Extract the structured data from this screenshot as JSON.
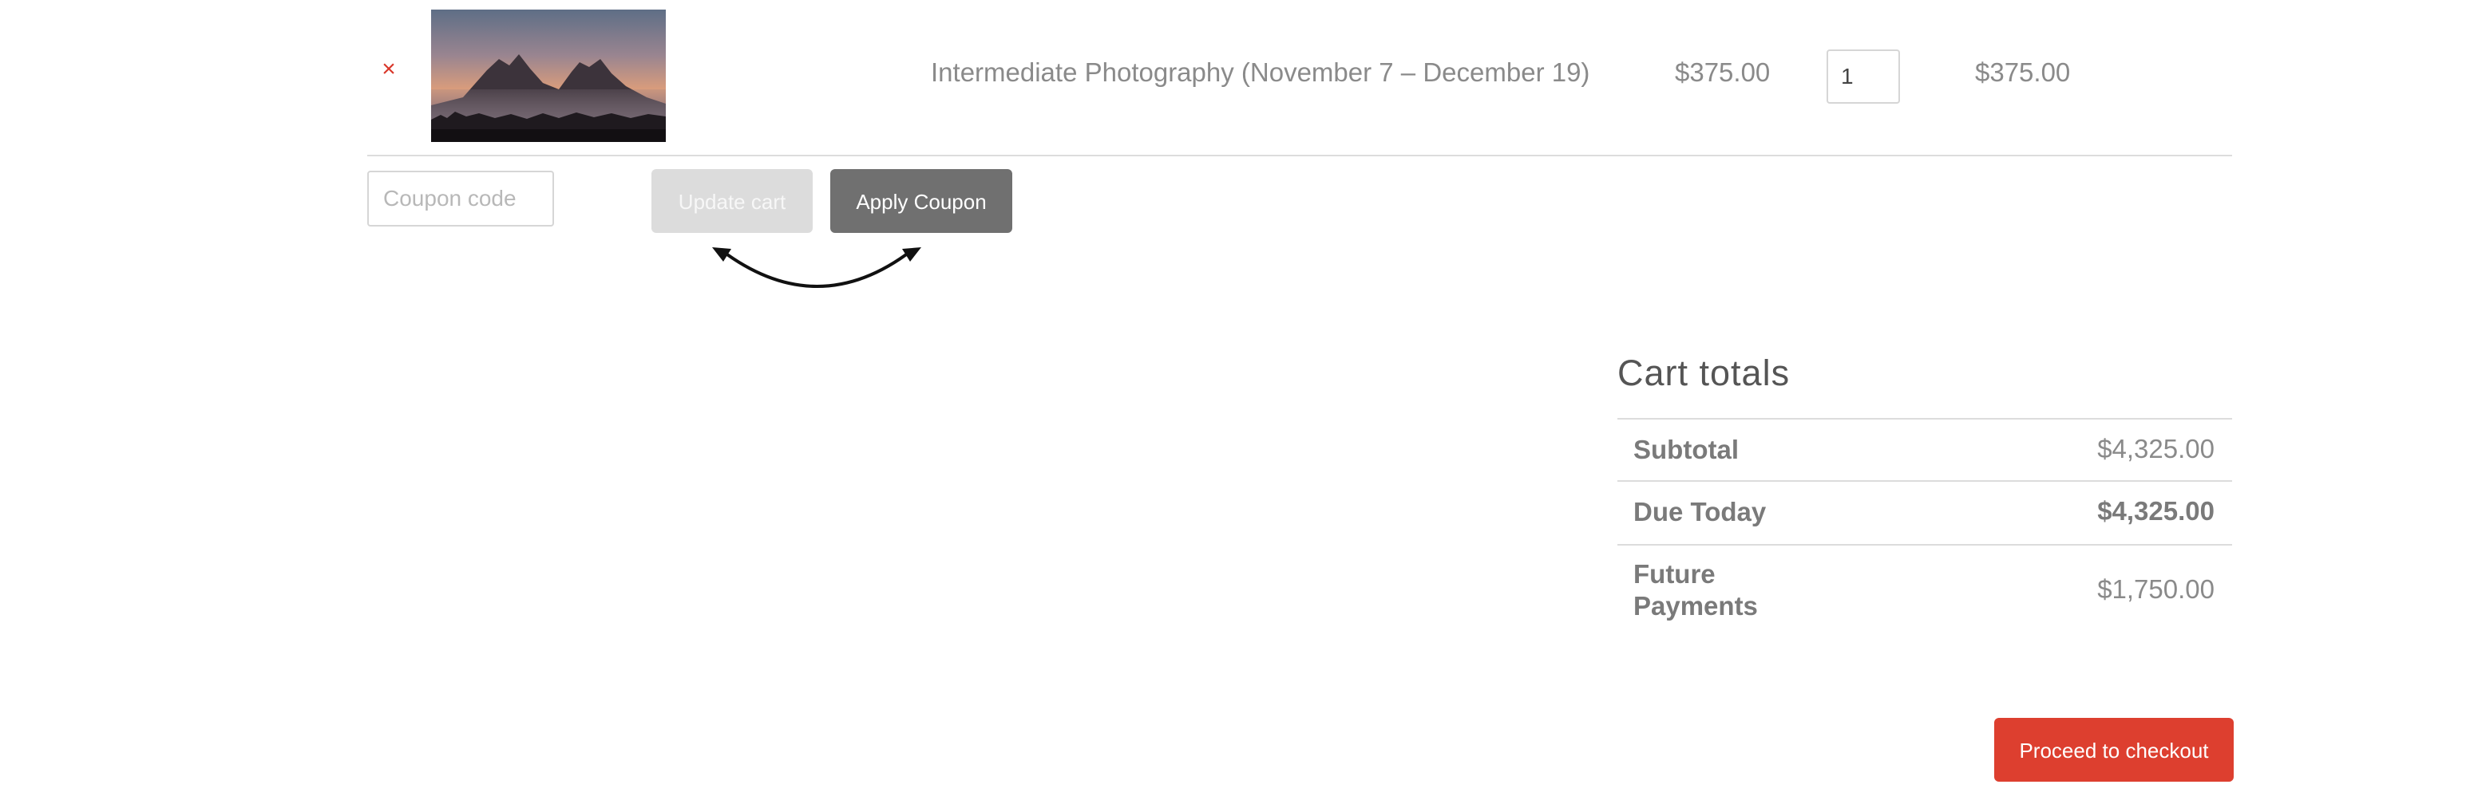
{
  "cart_item": {
    "remove_symbol": "×",
    "product_name": "Intermediate Photography (November 7 – December 19)",
    "price": "$375.00",
    "quantity": "1",
    "subtotal": "$375.00"
  },
  "actions": {
    "coupon_placeholder": "Coupon code",
    "update_cart_label": "Update cart",
    "apply_coupon_label": "Apply Coupon"
  },
  "cart_totals": {
    "title": "Cart totals",
    "rows": [
      {
        "label": "Subtotal",
        "value": "$4,325.00"
      },
      {
        "label": "Due Today",
        "value": "$4,325.00"
      },
      {
        "label_line1": "Future",
        "label_line2": "Payments",
        "value": "$1,750.00"
      }
    ]
  },
  "checkout": {
    "proceed_label": "Proceed to checkout"
  },
  "colors": {
    "remove": "#d9372a",
    "checkout_button": "#dd3f2f",
    "apply_coupon_button": "#707070",
    "update_cart_button": "#dcdcdc"
  },
  "icons": {
    "annotation": "curved-double-arrow-icon"
  }
}
